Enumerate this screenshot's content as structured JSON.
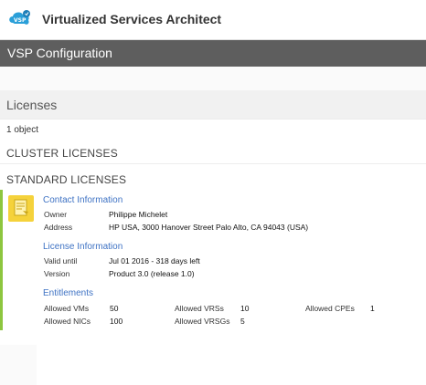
{
  "header": {
    "logo_text": "VSP",
    "app_title": "Virtualized Services Architect"
  },
  "config_bar": {
    "title": "VSP Configuration"
  },
  "licenses": {
    "title": "Licenses",
    "object_count": "1 object",
    "cluster_heading": "CLUSTER LICENSES",
    "standard_heading": "STANDARD LICENSES"
  },
  "license_card": {
    "accent_color": "#8dc63f",
    "icon": "license-document-icon",
    "contact": {
      "title": "Contact Information",
      "owner_label": "Owner",
      "owner_value": "Philippe Michelet",
      "address_label": "Address",
      "address_value": "HP USA, 3000 Hanover Street Palo Alto, CA 94043 (USA)"
    },
    "license_info": {
      "title": "License Information",
      "valid_label": "Valid until",
      "valid_value": "Jul 01 2016 - 318 days left",
      "version_label": "Version",
      "version_value": "Product 3.0 (release 1.0)"
    },
    "entitlements": {
      "title": "Entitlements",
      "vms_label": "Allowed VMs",
      "vms_value": "50",
      "nics_label": "Allowed NICs",
      "nics_value": "100",
      "vrss_label": "Allowed VRSs",
      "vrss_value": "10",
      "vrsgs_label": "Allowed VRSGs",
      "vrsgs_value": "5",
      "cpes_label": "Allowed CPEs",
      "cpes_value": "1"
    }
  }
}
